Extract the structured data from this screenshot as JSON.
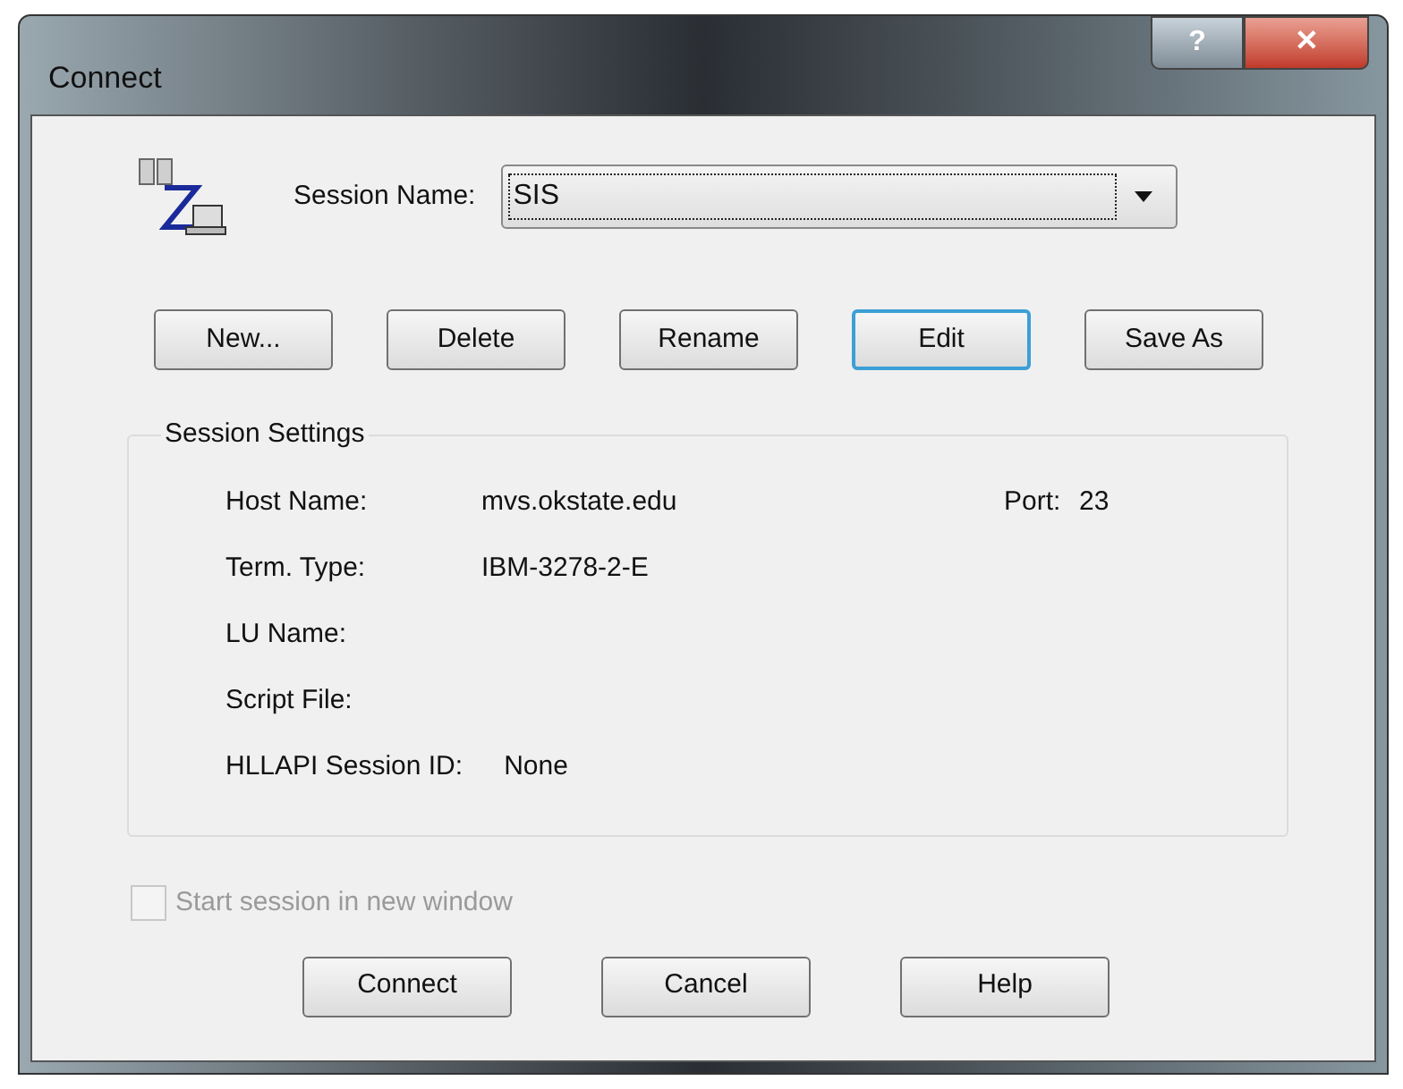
{
  "window": {
    "title": "Connect",
    "title_buttons": [
      "?",
      "✕"
    ]
  },
  "session_name": {
    "label": "Session Name:",
    "value": "SIS",
    "focused": true
  },
  "session_buttons": [
    {
      "label": "New...",
      "default": false
    },
    {
      "label": "Delete",
      "default": false
    },
    {
      "label": "Rename",
      "default": false
    },
    {
      "label": "Edit",
      "default": true
    },
    {
      "label": "Save As",
      "default": false
    }
  ],
  "session_settings": {
    "title": "Session Settings",
    "rows": [
      {
        "label": "Host Name:",
        "value": "mvs.okstate.edu",
        "extra_label": "Port:",
        "extra_value": "23"
      },
      {
        "label": "Term. Type:",
        "value": "IBM-3278-2-E"
      },
      {
        "label": "LU Name:"
      },
      {
        "label": "Script File:"
      },
      {
        "label": "HLLAPI Session ID:",
        "value": "None"
      }
    ]
  },
  "new_window_checkbox": {
    "label": "Start session in new window",
    "checked": false,
    "disabled": true
  },
  "dialog_buttons": [
    {
      "label": "Connect",
      "default": false
    },
    {
      "label": "Cancel",
      "default": false
    },
    {
      "label": "Help",
      "default": false
    }
  ]
}
